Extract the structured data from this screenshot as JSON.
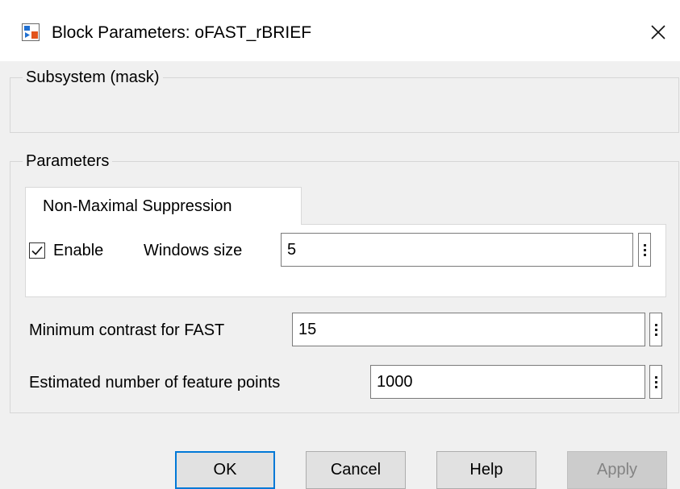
{
  "window": {
    "title": "Block Parameters: oFAST_rBRIEF",
    "app_icon": "simulink-block-icon",
    "close_glyph": "✕"
  },
  "subsystem_group": {
    "title": "Subsystem (mask)"
  },
  "parameters_group": {
    "title": "Parameters",
    "tabs": [
      {
        "label": "Non-Maximal Suppression",
        "selected": true
      }
    ],
    "nms": {
      "enable_checked": true,
      "enable_label": "Enable",
      "window_size_label": "Windows size",
      "window_size_value": "5"
    },
    "min_contrast_label": "Minimum contrast for FAST",
    "min_contrast_value": "15",
    "num_points_label": "Estimated number of feature points",
    "num_points_value": "1000"
  },
  "buttons": {
    "ok": "OK",
    "cancel": "Cancel",
    "help": "Help",
    "apply": "Apply"
  },
  "colors": {
    "accent": "#0078d7",
    "dialog_bg": "#f0f0f0",
    "disabled_text": "#838383"
  }
}
